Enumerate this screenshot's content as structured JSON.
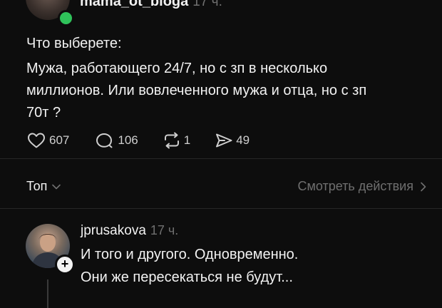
{
  "post": {
    "username": "mama_ot_bloga",
    "time": "17 ч.",
    "lines": [
      "Что выберете:",
      "Мужа, работающего 24/7, но с зп в несколько",
      "миллионов. Или вовлеченного мужа и отца, но с зп",
      "70т ?"
    ],
    "stats": {
      "likes": "607",
      "comments": "106",
      "reposts": "1",
      "shares": "49"
    }
  },
  "sort": {
    "label": "Топ"
  },
  "view_activity": {
    "label": "Смотреть действия"
  },
  "reply": {
    "username": "jprusakova",
    "time": "17 ч.",
    "lines": [
      "И того и другого. Одновременно.",
      "Они же пересекаться не будут..."
    ],
    "plus_glyph": "+"
  },
  "colors": {
    "online": "#2fc25a",
    "muted": "#6f6f6f",
    "background": "#0d0d0d"
  }
}
